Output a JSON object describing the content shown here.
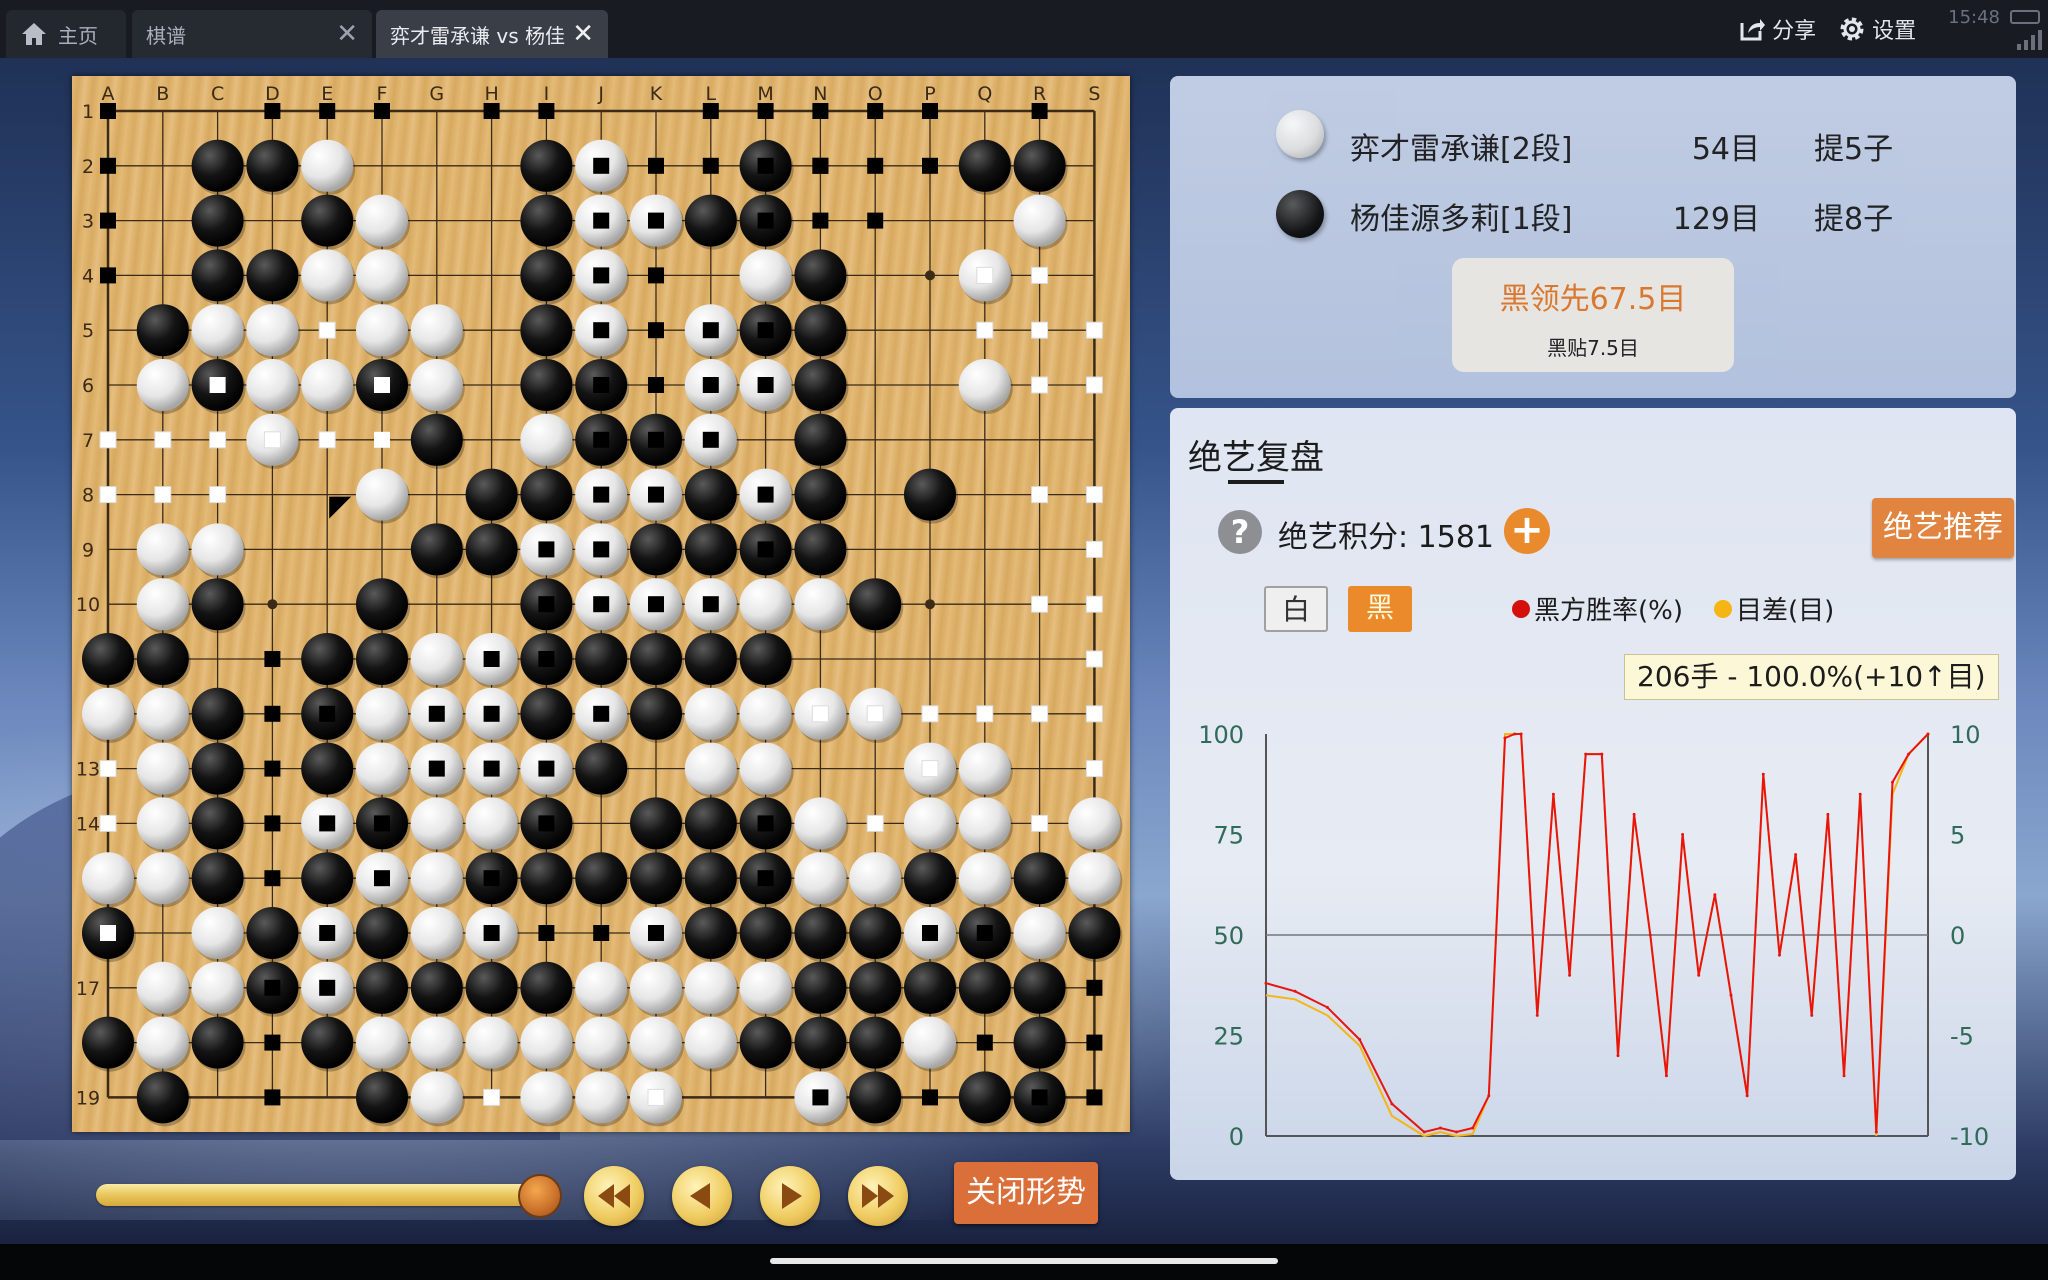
{
  "tabs": {
    "home_label": "主页",
    "qipu_label": "棋谱",
    "game_label": "弈才雷承谦 vs 杨佳",
    "close_glyph": "✕"
  },
  "toolbar": {
    "share_label": "分享",
    "settings_label": "设置",
    "clock": "15:48"
  },
  "board": {
    "columns": [
      "A",
      "B",
      "C",
      "D",
      "E",
      "F",
      "G",
      "H",
      "I",
      "J",
      "K",
      "L",
      "M",
      "N",
      "O",
      "P",
      "Q",
      "R",
      "S"
    ],
    "row_labels": [
      "1",
      "2",
      "3",
      "4",
      "5",
      "6",
      "7",
      "8",
      "9",
      "10",
      "",
      "",
      "13",
      "14",
      "",
      "",
      "17",
      "",
      "19"
    ],
    "rows": [
      "*..***.**..*****.*.",
      "*.XXO...XO*.X***XX.",
      "*.X.XO..XOOXX.*..O.",
      "*.XXOO..XO*.OX..O..",
      ".XOO.OO.XO*OXX.....",
      ".OXOOXO.XX*OOX..O..",
      "...O..X.OXXO.X.....",
      ".....O.XXOOXOX.X...",
      ".OO...XXOOXXXX.....",
      ".OX..X..XOOOOOX....",
      "XX..XXOOXXXXX......",
      "OOX.XOOOXOXOOOO....",
      ".OX.XOOOOX.OO..OO..",
      ".OX.OXOOX.XXXO.OO.O",
      "OOX.XOOXXXXXXOOXOXO",
      "X.OXOXOO..OXXXXOXOX",
      ".OOXOXXXXOOOOXXXXX.",
      "XOX.XOOOOOOOXXXO.X.",
      ".X...XO.OOO..OX.XX."
    ],
    "markers": {
      "move_white": "白",
      "move_black": "黑"
    }
  },
  "players": {
    "white": {
      "name": "弈才雷承谦[2段]",
      "territory": "54目",
      "captures": "提5子"
    },
    "black": {
      "name": "杨佳源多莉[1段]",
      "territory": "129目",
      "captures": "提8子"
    }
  },
  "lead": {
    "main": "黑领先67.5目",
    "komi": "黑贴7.5目"
  },
  "analysis": {
    "title": "绝艺复盘",
    "score_label": "绝艺积分: 1581",
    "recommend_label": "绝艺推荐",
    "side_white": "白",
    "side_black": "黑",
    "legend_winrate": "黑方胜率(%)",
    "legend_margin": "目差(目)",
    "tooltip": "206手 - 100.0%(+10↑目)",
    "plus_glyph": "+",
    "help_glyph": "?"
  },
  "controls": {
    "close_situation": "关闭形势",
    "slider_position": 0.95
  },
  "colors": {
    "winrate_line": "#e8140f",
    "margin_line": "#f5b514",
    "accent_orange": "#e08440",
    "axis_text": "#2f6b58"
  },
  "chart_data": {
    "type": "line",
    "title": "",
    "xlabel": "",
    "ylabel": "",
    "ylim": [
      0,
      100
    ],
    "y2lim": [
      -10,
      10
    ],
    "yticks": [
      100,
      75,
      50,
      25,
      0
    ],
    "y2ticks": [
      10,
      5,
      0,
      -5,
      -10
    ],
    "grid": "horizontal line at 50",
    "x": [
      1,
      10,
      20,
      30,
      40,
      50,
      55,
      60,
      65,
      70,
      75,
      78,
      80,
      85,
      90,
      95,
      100,
      105,
      110,
      115,
      120,
      125,
      130,
      135,
      140,
      145,
      150,
      155,
      160,
      165,
      170,
      175,
      180,
      185,
      190,
      195,
      200,
      206
    ],
    "series": [
      {
        "name": "黑方胜率(%)",
        "values": [
          38,
          36,
          32,
          24,
          8,
          1,
          2,
          1,
          2,
          10,
          99,
          100,
          100,
          30,
          85,
          40,
          95,
          95,
          20,
          80,
          50,
          15,
          75,
          40,
          60,
          35,
          10,
          90,
          45,
          70,
          30,
          80,
          15,
          85,
          1,
          88,
          95,
          100
        ]
      },
      {
        "name": "目差(目)",
        "values": [
          -3,
          -3.2,
          -4,
          -5.5,
          -9,
          -10,
          -9.8,
          -10,
          -9.9,
          -8,
          10,
          10,
          10,
          -4,
          7,
          -2,
          9,
          9,
          -6,
          6,
          0,
          -7,
          5,
          -2,
          2,
          -3,
          -8,
          8,
          -1,
          4,
          -4,
          6,
          -7,
          7,
          -10,
          7,
          9,
          10
        ]
      }
    ]
  }
}
